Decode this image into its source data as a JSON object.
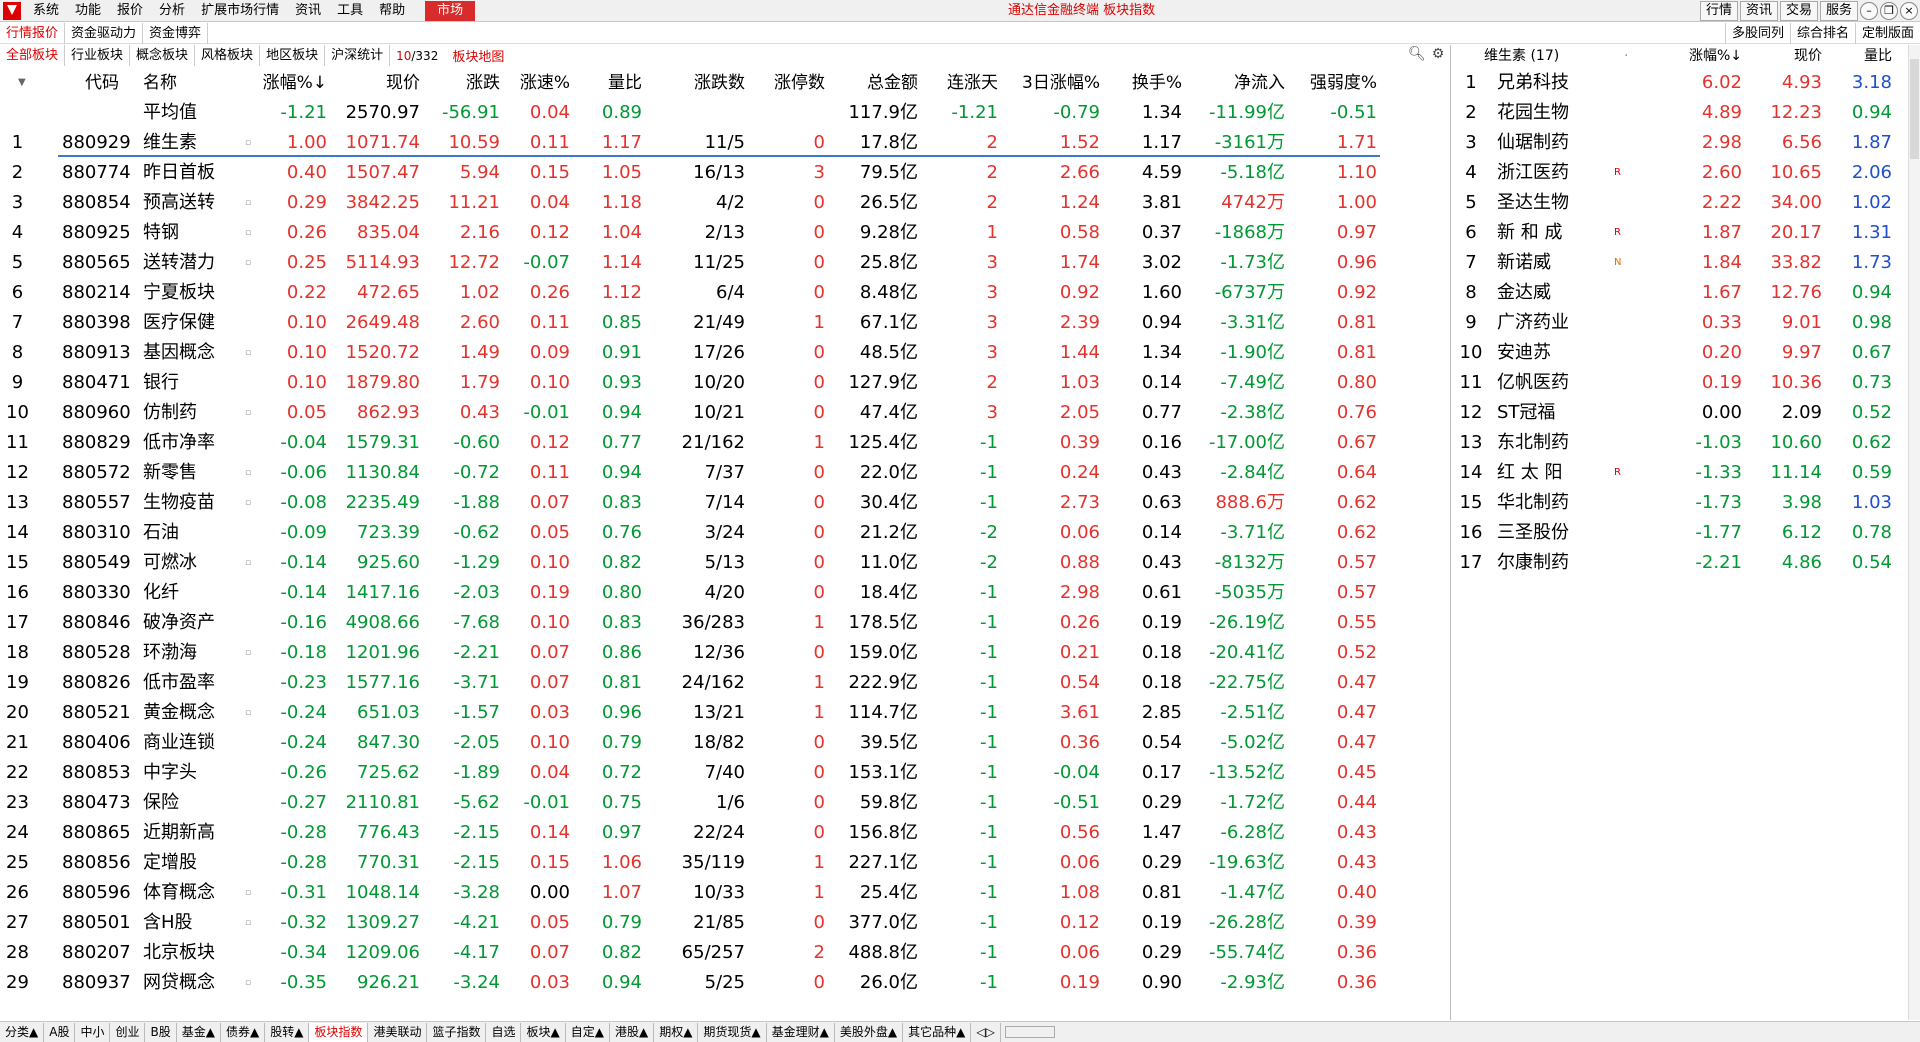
{
  "menu": [
    "系统",
    "功能",
    "报价",
    "分析",
    "扩展市场行情",
    "资讯",
    "工具",
    "帮助"
  ],
  "market_button": "市场",
  "app_title": "通达信金融终端  板块指数",
  "top_right": [
    "行情",
    "资讯",
    "交易",
    "服务"
  ],
  "tabs1": [
    "行情报价",
    "资金驱动力",
    "资金博弈"
  ],
  "tabs1_right": [
    "多股同列",
    "综合排名",
    "定制版面"
  ],
  "tabs2": [
    "全部板块",
    "行业板块",
    "概念板块",
    "风格板块",
    "地区板块",
    "沪深统计"
  ],
  "page_count": {
    "current": "10",
    "total": "/332"
  },
  "board_map": "板块地图",
  "columns": [
    "代码",
    "名称",
    "涨幅%↓",
    "现价",
    "涨跌",
    "涨速%",
    "量比",
    "涨跌数",
    "涨停数",
    "总金额",
    "连涨天",
    "3日涨幅%",
    "换手%",
    "净流入",
    "强弱度%"
  ],
  "average": {
    "name": "平均值",
    "pct": "-1.21",
    "price": "2570.97",
    "chg": "-56.91",
    "speed": "0.04",
    "vr": "0.89",
    "ud": "",
    "lim": "",
    "amt": "117.9亿",
    "days": "-1.21",
    "d3": "-0.79",
    "turn": "1.34",
    "net": "-11.99亿",
    "rs": "-0.51"
  },
  "rows": [
    {
      "n": "1",
      "code": "880929",
      "name": "维生素",
      "flag": "▫",
      "pct": "1.00",
      "price": "1071.74",
      "chg": "10.59",
      "speed": "0.11",
      "vr": "1.17",
      "ud": "11/5",
      "lim": "0",
      "amt": "17.8亿",
      "days": "2",
      "d3": "1.52",
      "turn": "1.17",
      "net": "-3161万",
      "rs": "1.71"
    },
    {
      "n": "2",
      "code": "880774",
      "name": "昨日首板",
      "flag": "",
      "pct": "0.40",
      "price": "1507.47",
      "chg": "5.94",
      "speed": "0.15",
      "vr": "1.05",
      "ud": "16/13",
      "lim": "3",
      "amt": "79.5亿",
      "days": "2",
      "d3": "2.66",
      "turn": "4.59",
      "net": "-5.18亿",
      "rs": "1.10"
    },
    {
      "n": "3",
      "code": "880854",
      "name": "预高送转",
      "flag": "▫",
      "pct": "0.29",
      "price": "3842.25",
      "chg": "11.21",
      "speed": "0.04",
      "vr": "1.18",
      "ud": "4/2",
      "lim": "0",
      "amt": "26.5亿",
      "days": "2",
      "d3": "1.24",
      "turn": "3.81",
      "net": "4742万",
      "rs": "1.00"
    },
    {
      "n": "4",
      "code": "880925",
      "name": "特钢",
      "flag": "▫",
      "pct": "0.26",
      "price": "835.04",
      "chg": "2.16",
      "speed": "0.12",
      "vr": "1.04",
      "ud": "2/13",
      "lim": "0",
      "amt": "9.28亿",
      "days": "1",
      "d3": "0.58",
      "turn": "0.37",
      "net": "-1868万",
      "rs": "0.97"
    },
    {
      "n": "5",
      "code": "880565",
      "name": "送转潜力",
      "flag": "▫",
      "pct": "0.25",
      "price": "5114.93",
      "chg": "12.72",
      "speed": "-0.07",
      "vr": "1.14",
      "ud": "11/25",
      "lim": "0",
      "amt": "25.8亿",
      "days": "3",
      "d3": "1.74",
      "turn": "3.02",
      "net": "-1.73亿",
      "rs": "0.96"
    },
    {
      "n": "6",
      "code": "880214",
      "name": "宁夏板块",
      "flag": "",
      "pct": "0.22",
      "price": "472.65",
      "chg": "1.02",
      "speed": "0.26",
      "vr": "1.12",
      "ud": "6/4",
      "lim": "0",
      "amt": "8.48亿",
      "days": "3",
      "d3": "0.92",
      "turn": "1.60",
      "net": "-6737万",
      "rs": "0.92"
    },
    {
      "n": "7",
      "code": "880398",
      "name": "医疗保健",
      "flag": "",
      "pct": "0.10",
      "price": "2649.48",
      "chg": "2.60",
      "speed": "0.11",
      "vr": "0.85",
      "ud": "21/49",
      "lim": "1",
      "amt": "67.1亿",
      "days": "3",
      "d3": "2.39",
      "turn": "0.94",
      "net": "-3.31亿",
      "rs": "0.81"
    },
    {
      "n": "8",
      "code": "880913",
      "name": "基因概念",
      "flag": "▫",
      "pct": "0.10",
      "price": "1520.72",
      "chg": "1.49",
      "speed": "0.09",
      "vr": "0.91",
      "ud": "17/26",
      "lim": "0",
      "amt": "48.5亿",
      "days": "3",
      "d3": "1.44",
      "turn": "1.34",
      "net": "-1.90亿",
      "rs": "0.81"
    },
    {
      "n": "9",
      "code": "880471",
      "name": "银行",
      "flag": "",
      "pct": "0.10",
      "price": "1879.80",
      "chg": "1.79",
      "speed": "0.10",
      "vr": "0.93",
      "ud": "10/20",
      "lim": "0",
      "amt": "127.9亿",
      "days": "2",
      "d3": "1.03",
      "turn": "0.14",
      "net": "-7.49亿",
      "rs": "0.80"
    },
    {
      "n": "10",
      "code": "880960",
      "name": "仿制药",
      "flag": "▫",
      "pct": "0.05",
      "price": "862.93",
      "chg": "0.43",
      "speed": "-0.01",
      "vr": "0.94",
      "ud": "10/21",
      "lim": "0",
      "amt": "47.4亿",
      "days": "3",
      "d3": "2.05",
      "turn": "0.77",
      "net": "-2.38亿",
      "rs": "0.76"
    },
    {
      "n": "11",
      "code": "880829",
      "name": "低市净率",
      "flag": "",
      "pct": "-0.04",
      "price": "1579.31",
      "chg": "-0.60",
      "speed": "0.12",
      "vr": "0.77",
      "ud": "21/162",
      "lim": "1",
      "amt": "125.4亿",
      "days": "-1",
      "d3": "0.39",
      "turn": "0.16",
      "net": "-17.00亿",
      "rs": "0.67"
    },
    {
      "n": "12",
      "code": "880572",
      "name": "新零售",
      "flag": "▫",
      "pct": "-0.06",
      "price": "1130.84",
      "chg": "-0.72",
      "speed": "0.11",
      "vr": "0.94",
      "ud": "7/37",
      "lim": "0",
      "amt": "22.0亿",
      "days": "-1",
      "d3": "0.24",
      "turn": "0.43",
      "net": "-2.84亿",
      "rs": "0.64"
    },
    {
      "n": "13",
      "code": "880557",
      "name": "生物疫苗",
      "flag": "▫",
      "pct": "-0.08",
      "price": "2235.49",
      "chg": "-1.88",
      "speed": "0.07",
      "vr": "0.83",
      "ud": "7/14",
      "lim": "0",
      "amt": "30.4亿",
      "days": "-1",
      "d3": "2.73",
      "turn": "0.63",
      "net": "888.6万",
      "rs": "0.62"
    },
    {
      "n": "14",
      "code": "880310",
      "name": "石油",
      "flag": "",
      "pct": "-0.09",
      "price": "723.39",
      "chg": "-0.62",
      "speed": "0.05",
      "vr": "0.76",
      "ud": "3/24",
      "lim": "0",
      "amt": "21.2亿",
      "days": "-2",
      "d3": "0.06",
      "turn": "0.14",
      "net": "-3.71亿",
      "rs": "0.62"
    },
    {
      "n": "15",
      "code": "880549",
      "name": "可燃冰",
      "flag": "▫",
      "pct": "-0.14",
      "price": "925.60",
      "chg": "-1.29",
      "speed": "0.10",
      "vr": "0.82",
      "ud": "5/13",
      "lim": "0",
      "amt": "11.0亿",
      "days": "-2",
      "d3": "0.88",
      "turn": "0.43",
      "net": "-8132万",
      "rs": "0.57"
    },
    {
      "n": "16",
      "code": "880330",
      "name": "化纤",
      "flag": "",
      "pct": "-0.14",
      "price": "1417.16",
      "chg": "-2.03",
      "speed": "0.19",
      "vr": "0.80",
      "ud": "4/20",
      "lim": "0",
      "amt": "18.4亿",
      "days": "-1",
      "d3": "2.98",
      "turn": "0.61",
      "net": "-5035万",
      "rs": "0.57"
    },
    {
      "n": "17",
      "code": "880846",
      "name": "破净资产",
      "flag": "",
      "pct": "-0.16",
      "price": "4908.66",
      "chg": "-7.68",
      "speed": "0.10",
      "vr": "0.83",
      "ud": "36/283",
      "lim": "1",
      "amt": "178.5亿",
      "days": "-1",
      "d3": "0.26",
      "turn": "0.19",
      "net": "-26.19亿",
      "rs": "0.55"
    },
    {
      "n": "18",
      "code": "880528",
      "name": "环渤海",
      "flag": "▫",
      "pct": "-0.18",
      "price": "1201.96",
      "chg": "-2.21",
      "speed": "0.07",
      "vr": "0.86",
      "ud": "12/36",
      "lim": "0",
      "amt": "159.0亿",
      "days": "-1",
      "d3": "0.21",
      "turn": "0.18",
      "net": "-20.41亿",
      "rs": "0.52"
    },
    {
      "n": "19",
      "code": "880826",
      "name": "低市盈率",
      "flag": "",
      "pct": "-0.23",
      "price": "1577.16",
      "chg": "-3.71",
      "speed": "0.07",
      "vr": "0.81",
      "ud": "24/162",
      "lim": "1",
      "amt": "222.9亿",
      "days": "-1",
      "d3": "0.54",
      "turn": "0.18",
      "net": "-22.75亿",
      "rs": "0.47"
    },
    {
      "n": "20",
      "code": "880521",
      "name": "黄金概念",
      "flag": "▫",
      "pct": "-0.24",
      "price": "651.03",
      "chg": "-1.57",
      "speed": "0.03",
      "vr": "0.96",
      "ud": "13/21",
      "lim": "1",
      "amt": "114.7亿",
      "days": "-1",
      "d3": "3.61",
      "turn": "2.85",
      "net": "-2.51亿",
      "rs": "0.47"
    },
    {
      "n": "21",
      "code": "880406",
      "name": "商业连锁",
      "flag": "",
      "pct": "-0.24",
      "price": "847.30",
      "chg": "-2.05",
      "speed": "0.10",
      "vr": "0.79",
      "ud": "18/82",
      "lim": "0",
      "amt": "39.5亿",
      "days": "-1",
      "d3": "0.36",
      "turn": "0.54",
      "net": "-5.02亿",
      "rs": "0.47"
    },
    {
      "n": "22",
      "code": "880853",
      "name": "中字头",
      "flag": "",
      "pct": "-0.26",
      "price": "725.62",
      "chg": "-1.89",
      "speed": "0.04",
      "vr": "0.72",
      "ud": "7/40",
      "lim": "0",
      "amt": "153.1亿",
      "days": "-1",
      "d3": "-0.04",
      "turn": "0.17",
      "net": "-13.52亿",
      "rs": "0.45"
    },
    {
      "n": "23",
      "code": "880473",
      "name": "保险",
      "flag": "",
      "pct": "-0.27",
      "price": "2110.81",
      "chg": "-5.62",
      "speed": "-0.01",
      "vr": "0.75",
      "ud": "1/6",
      "lim": "0",
      "amt": "59.8亿",
      "days": "-1",
      "d3": "-0.51",
      "turn": "0.29",
      "net": "-1.72亿",
      "rs": "0.44"
    },
    {
      "n": "24",
      "code": "880865",
      "name": "近期新高",
      "flag": "",
      "pct": "-0.28",
      "price": "776.43",
      "chg": "-2.15",
      "speed": "0.14",
      "vr": "0.97",
      "ud": "22/24",
      "lim": "0",
      "amt": "156.8亿",
      "days": "-1",
      "d3": "0.56",
      "turn": "1.47",
      "net": "-6.28亿",
      "rs": "0.43"
    },
    {
      "n": "25",
      "code": "880856",
      "name": "定增股",
      "flag": "",
      "pct": "-0.28",
      "price": "770.31",
      "chg": "-2.15",
      "speed": "0.15",
      "vr": "1.06",
      "ud": "35/119",
      "lim": "1",
      "amt": "227.1亿",
      "days": "-1",
      "d3": "0.06",
      "turn": "0.29",
      "net": "-19.63亿",
      "rs": "0.43"
    },
    {
      "n": "26",
      "code": "880596",
      "name": "体育概念",
      "flag": "▫",
      "pct": "-0.31",
      "price": "1048.14",
      "chg": "-3.28",
      "speed": "0.00",
      "vr": "1.07",
      "ud": "10/33",
      "lim": "1",
      "amt": "25.4亿",
      "days": "-1",
      "d3": "1.08",
      "turn": "0.81",
      "net": "-1.47亿",
      "rs": "0.40"
    },
    {
      "n": "27",
      "code": "880501",
      "name": "含H股",
      "flag": "▫",
      "pct": "-0.32",
      "price": "1309.27",
      "chg": "-4.21",
      "speed": "0.05",
      "vr": "0.79",
      "ud": "21/85",
      "lim": "0",
      "amt": "377.0亿",
      "days": "-1",
      "d3": "0.12",
      "turn": "0.19",
      "net": "-26.28亿",
      "rs": "0.39"
    },
    {
      "n": "28",
      "code": "880207",
      "name": "北京板块",
      "flag": "",
      "pct": "-0.34",
      "price": "1209.06",
      "chg": "-4.17",
      "speed": "0.07",
      "vr": "0.82",
      "ud": "65/257",
      "lim": "2",
      "amt": "488.8亿",
      "days": "-1",
      "d3": "0.06",
      "turn": "0.29",
      "net": "-55.74亿",
      "rs": "0.36"
    },
    {
      "n": "29",
      "code": "880937",
      "name": "网贷概念",
      "flag": "▫",
      "pct": "-0.35",
      "price": "926.21",
      "chg": "-3.24",
      "speed": "0.03",
      "vr": "0.94",
      "ud": "5/25",
      "lim": "0",
      "amt": "26.0亿",
      "days": "-1",
      "d3": "0.19",
      "turn": "0.90",
      "net": "-2.93亿",
      "rs": "0.36"
    }
  ],
  "right_panel": {
    "title": "维生素 (17)",
    "dot": "·",
    "columns": [
      "涨幅%↓",
      "现价",
      "量比"
    ],
    "rows": [
      {
        "n": "1",
        "name": "兄弟科技",
        "flag": "",
        "pct": "6.02",
        "price": "4.93",
        "vr": "3.18"
      },
      {
        "n": "2",
        "name": "花园生物",
        "flag": "",
        "pct": "4.89",
        "price": "12.23",
        "vr": "0.94"
      },
      {
        "n": "3",
        "name": "仙琚制药",
        "flag": "",
        "pct": "2.98",
        "price": "6.56",
        "vr": "1.87"
      },
      {
        "n": "4",
        "name": "浙江医药",
        "flag": "R",
        "pct": "2.60",
        "price": "10.65",
        "vr": "2.06"
      },
      {
        "n": "5",
        "name": "圣达生物",
        "flag": "",
        "pct": "2.22",
        "price": "34.00",
        "vr": "1.02"
      },
      {
        "n": "6",
        "name": "新 和 成",
        "flag": "R",
        "pct": "1.87",
        "price": "20.17",
        "vr": "1.31"
      },
      {
        "n": "7",
        "name": "新诺威",
        "flag": "N",
        "pct": "1.84",
        "price": "33.82",
        "vr": "1.73"
      },
      {
        "n": "8",
        "name": "金达威",
        "flag": "",
        "pct": "1.67",
        "price": "12.76",
        "vr": "0.94"
      },
      {
        "n": "9",
        "name": "广济药业",
        "flag": "",
        "pct": "0.33",
        "price": "9.01",
        "vr": "0.98"
      },
      {
        "n": "10",
        "name": "安迪苏",
        "flag": "",
        "pct": "0.20",
        "price": "9.97",
        "vr": "0.67"
      },
      {
        "n": "11",
        "name": "亿帆医药",
        "flag": "",
        "pct": "0.19",
        "price": "10.36",
        "vr": "0.73"
      },
      {
        "n": "12",
        "name": "ST冠福",
        "flag": "",
        "pct": "0.00",
        "price": "2.09",
        "vr": "0.52"
      },
      {
        "n": "13",
        "name": "东北制药",
        "flag": "",
        "pct": "-1.03",
        "price": "10.60",
        "vr": "0.62"
      },
      {
        "n": "14",
        "name": "红 太 阳",
        "flag": "R",
        "pct": "-1.33",
        "price": "11.14",
        "vr": "0.59"
      },
      {
        "n": "15",
        "name": "华北制药",
        "flag": "",
        "pct": "-1.73",
        "price": "3.98",
        "vr": "1.03"
      },
      {
        "n": "16",
        "name": "三圣股份",
        "flag": "",
        "pct": "-1.77",
        "price": "6.12",
        "vr": "0.78"
      },
      {
        "n": "17",
        "name": "尔康制药",
        "flag": "",
        "pct": "-2.21",
        "price": "4.86",
        "vr": "0.54"
      }
    ]
  },
  "bottom_tabs": [
    "分类▲",
    "A股",
    "中小",
    "创业",
    "B股",
    "基金▲",
    "债券▲",
    "股转▲",
    "板块指数",
    "港美联动",
    "篮子指数",
    "自选",
    "板块▲",
    "自定▲",
    "港股▲",
    "期权▲",
    "期货现货▲",
    "基金理财▲",
    "美股外盘▲",
    "其它品种▲",
    "◁▷"
  ],
  "bottom_active": "板块指数",
  "colors": {
    "up": "#e5322d",
    "down": "#009933",
    "accent": "#d00000",
    "selection": "#3d7ac9"
  }
}
